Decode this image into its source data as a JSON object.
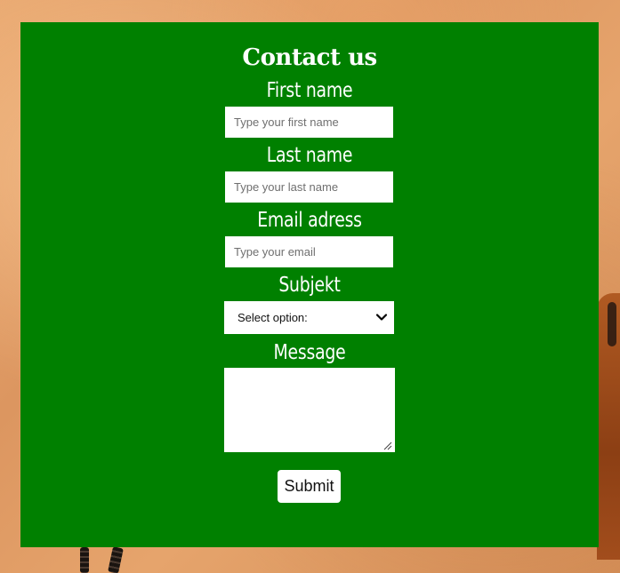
{
  "form": {
    "title": "Contact us",
    "first_name": {
      "label": "First name",
      "placeholder": "Type your first name"
    },
    "last_name": {
      "label": "Last name",
      "placeholder": "Type your last name"
    },
    "email": {
      "label": "Email adress",
      "placeholder": "Type your email"
    },
    "subject": {
      "label": "Subjekt",
      "selected": "Select option:"
    },
    "message": {
      "label": "Message",
      "value": ""
    },
    "submit_label": "Submit"
  },
  "colors": {
    "panel": "#008000",
    "text": "#ffffff",
    "background": "#e0a06a"
  },
  "icons": {
    "select_arrow": "chevron-down-icon",
    "textarea_resize": "resize-handle-icon"
  }
}
